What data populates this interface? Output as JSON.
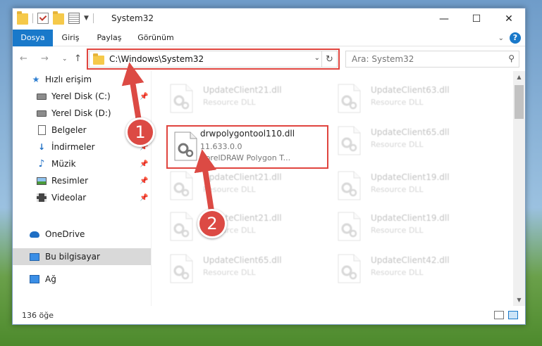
{
  "window": {
    "title": "System32",
    "caption": {
      "minimize": "—",
      "maximize": "☐",
      "close": "✕"
    }
  },
  "ribbon": {
    "tabs": [
      {
        "label": "Dosya",
        "active": true
      },
      {
        "label": "Giriş"
      },
      {
        "label": "Paylaş"
      },
      {
        "label": "Görünüm"
      }
    ],
    "help": "?"
  },
  "address": {
    "path": "C:\\Windows\\System32",
    "search_placeholder": "Ara: System32"
  },
  "nav": {
    "items": [
      {
        "label": "Hızlı erişim",
        "icon": "star-icon"
      },
      {
        "label": "Yerel Disk (C:)",
        "icon": "drive-icon"
      },
      {
        "label": "Yerel Disk (D:)",
        "icon": "drive-icon"
      },
      {
        "label": "Belgeler",
        "icon": "documents-icon"
      },
      {
        "label": "İndirmeler",
        "icon": "download-icon"
      },
      {
        "label": "Müzik",
        "icon": "music-icon"
      },
      {
        "label": "Resimler",
        "icon": "pictures-icon"
      },
      {
        "label": "Videolar",
        "icon": "videos-icon"
      },
      {
        "label": "OneDrive",
        "icon": "cloud-icon"
      },
      {
        "label": "Bu bilgisayar",
        "icon": "computer-icon",
        "selected": true
      },
      {
        "label": "Ağ",
        "icon": "network-icon"
      }
    ]
  },
  "files": {
    "left": [
      {
        "name": "UpdateClient21.dll",
        "type": "Resource DLL"
      },
      {
        "name": "drwpolygontool110.dll",
        "version": "11.633.0.0",
        "type": "CorelDRAW Polygon T..."
      },
      {
        "name": "UpdateClient21.dll",
        "type": "Resource DLL"
      },
      {
        "name": "UpdateClient21.dll",
        "type": "Resource DLL"
      },
      {
        "name": "UpdateClient65.dll",
        "type": "Resource DLL"
      }
    ],
    "right": [
      {
        "name": "UpdateClient63.dll",
        "type": "Resource DLL"
      },
      {
        "name": "UpdateClient65.dll",
        "type": "Resource DLL"
      },
      {
        "name": "UpdateClient19.dll",
        "type": "Resource DLL"
      },
      {
        "name": "UpdateClient19.dll",
        "type": "Resource DLL"
      },
      {
        "name": "UpdateClient42.dll",
        "type": "Resource DLL"
      }
    ]
  },
  "status": {
    "count": "136 öğe"
  },
  "annotations": {
    "step1": "1",
    "step2": "2",
    "color": "#dc4a44"
  }
}
